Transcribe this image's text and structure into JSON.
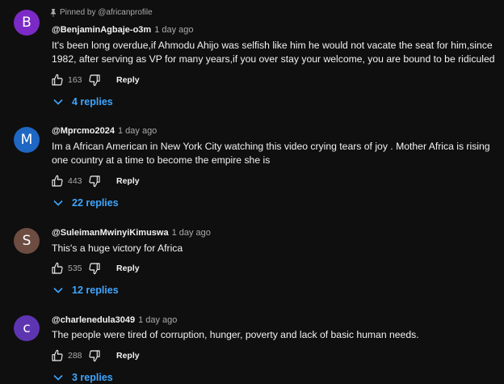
{
  "colors": {
    "background": "#0f0f0f",
    "link_blue": "#3ea6ff",
    "secondary_text": "#aaaaaa"
  },
  "comments": [
    {
      "avatar_letter": "B",
      "avatar_color": "#7b2ac6",
      "pinned_label": "Pinned by @africanprofile",
      "author": "@BenjaminAgbaje-o3m",
      "time": "1 day ago",
      "text": "It's been long overdue,if Ahmodu Ahijo was selfish like him he would not vacate the seat for him,since 1982, after serving as VP for many years,if you over stay your welcome, you are bound to be ridiculed",
      "likes": "163",
      "reply_label": "Reply",
      "replies_label": "4 replies"
    },
    {
      "avatar_letter": "M",
      "avatar_color": "#1e67c3",
      "author": "@Mprcmo2024",
      "time": "1 day ago",
      "text": "Im a African American in New York City watching this video crying tears of joy . Mother Africa is rising one country at a time to become the empire she is",
      "likes": "443",
      "reply_label": "Reply",
      "replies_label": "22 replies"
    },
    {
      "avatar_letter": "S",
      "avatar_color": "#6d4c41",
      "author": "@SuleimanMwinyiKimuswa",
      "time": "1 day ago",
      "text": "This's a huge victory for Africa",
      "likes": "535",
      "reply_label": "Reply",
      "replies_label": "12 replies"
    },
    {
      "avatar_letter": "c",
      "avatar_color": "#5e35b1",
      "author": "@charlenedula3049",
      "time": "1 day ago",
      "text": "The people were tired of corruption, hunger, poverty and lack of basic human needs.",
      "likes": "288",
      "reply_label": "Reply",
      "replies_label": "3 replies"
    }
  ],
  "icons": {
    "like": "thumbs-up-icon",
    "dislike": "thumbs-down-icon",
    "pin": "pin-icon",
    "expand": "chevron-down-icon"
  }
}
